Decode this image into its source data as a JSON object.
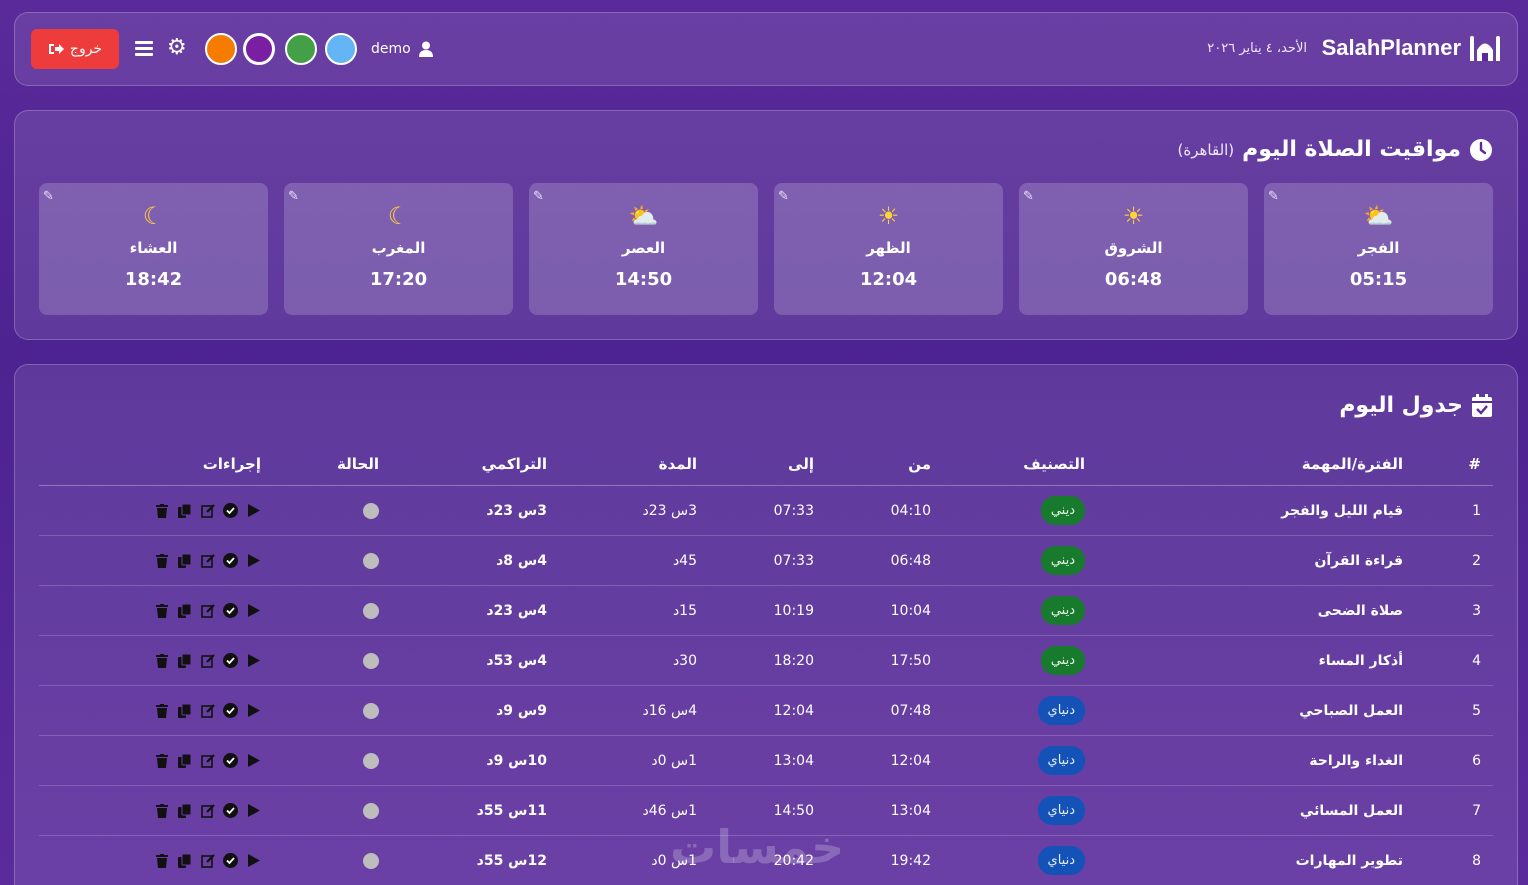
{
  "header": {
    "brand": "SalahPlanner",
    "date": "الأحد، ٤ يناير ٢٠٢٦",
    "user": "demo",
    "logout_label": "خروج",
    "theme_colors": [
      "#f57c00",
      "#7b1fa2",
      "#43a047",
      "#64b5f6"
    ]
  },
  "prayers": {
    "title": "مواقيت الصلاة اليوم",
    "city": "(القاهرة)",
    "items": [
      {
        "name": "الفجر",
        "time": "05:15",
        "icon": "sun-cloud-icon"
      },
      {
        "name": "الشروق",
        "time": "06:48",
        "icon": "sun-icon"
      },
      {
        "name": "الظهر",
        "time": "12:04",
        "icon": "sun-icon"
      },
      {
        "name": "العصر",
        "time": "14:50",
        "icon": "sun-cloud-icon"
      },
      {
        "name": "المغرب",
        "time": "17:20",
        "icon": "moon-icon"
      },
      {
        "name": "العشاء",
        "time": "18:42",
        "icon": "moon-icon"
      }
    ]
  },
  "schedule": {
    "title": "جدول اليوم",
    "columns": {
      "num": "#",
      "task": "الفترة/المهمة",
      "category": "التصنيف",
      "from": "من",
      "to": "إلى",
      "duration": "المدة",
      "cumulative": "التراكمي",
      "status": "الحالة",
      "actions": "إجراءات"
    },
    "rows": [
      {
        "num": "1",
        "task": "قيام الليل والفجر",
        "category": "ديني",
        "cat_type": "green",
        "from": "04:10",
        "to": "07:33",
        "duration": "3س 23د",
        "cumulative": "3س 23د"
      },
      {
        "num": "2",
        "task": "قراءة القرآن",
        "category": "ديني",
        "cat_type": "green",
        "from": "06:48",
        "to": "07:33",
        "duration": "45د",
        "cumulative": "4س 8د"
      },
      {
        "num": "3",
        "task": "صلاة الضحى",
        "category": "ديني",
        "cat_type": "green",
        "from": "10:04",
        "to": "10:19",
        "duration": "15د",
        "cumulative": "4س 23د"
      },
      {
        "num": "4",
        "task": "أذكار المساء",
        "category": "ديني",
        "cat_type": "green",
        "from": "17:50",
        "to": "18:20",
        "duration": "30د",
        "cumulative": "4س 53د"
      },
      {
        "num": "5",
        "task": "العمل الصباحي",
        "category": "دنياي",
        "cat_type": "blue",
        "from": "07:48",
        "to": "12:04",
        "duration": "4س 16د",
        "cumulative": "9س 9د"
      },
      {
        "num": "6",
        "task": "الغداء والراحة",
        "category": "دنياي",
        "cat_type": "blue",
        "from": "12:04",
        "to": "13:04",
        "duration": "1س 0د",
        "cumulative": "10س 9د"
      },
      {
        "num": "7",
        "task": "العمل المسائي",
        "category": "دنياي",
        "cat_type": "blue",
        "from": "13:04",
        "to": "14:50",
        "duration": "1س 46د",
        "cumulative": "11س 55د"
      },
      {
        "num": "8",
        "task": "تطوير المهارات",
        "category": "دنياي",
        "cat_type": "blue",
        "from": "19:42",
        "to": "20:42",
        "duration": "1س 0د",
        "cumulative": "12س 55د"
      }
    ]
  },
  "watermark": "خمسات"
}
